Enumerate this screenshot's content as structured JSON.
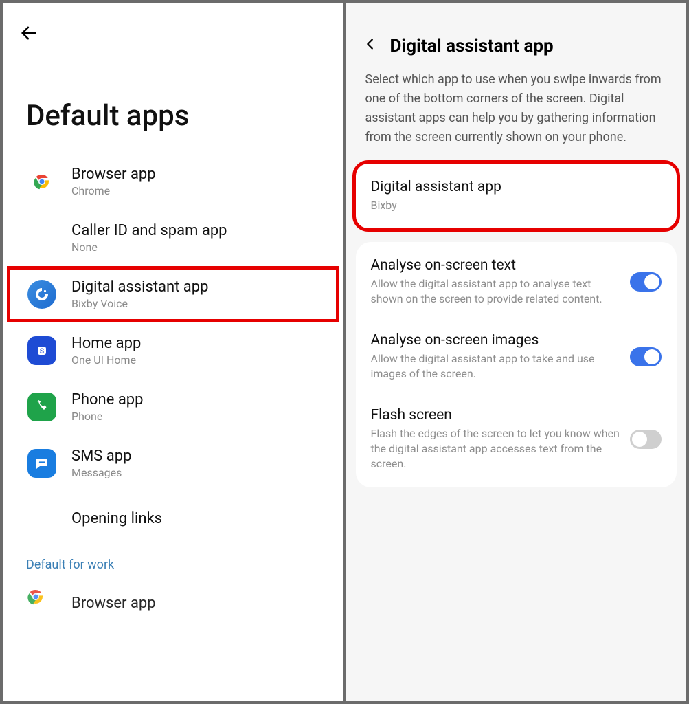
{
  "left": {
    "title": "Default apps",
    "items": [
      {
        "icon": "chrome",
        "title": "Browser app",
        "sub": "Chrome"
      },
      {
        "icon": "",
        "title": "Caller ID and spam app",
        "sub": "None"
      },
      {
        "icon": "bixby",
        "title": "Digital assistant app",
        "sub": "Bixby Voice"
      },
      {
        "icon": "samsung-home",
        "title": "Home app",
        "sub": "One UI Home"
      },
      {
        "icon": "phone",
        "title": "Phone app",
        "sub": "Phone"
      },
      {
        "icon": "messages",
        "title": "SMS app",
        "sub": "Messages"
      },
      {
        "icon": "",
        "title": "Opening links",
        "sub": ""
      }
    ],
    "footer_link": "Default for work",
    "partial_row": {
      "icon": "chrome",
      "title": "Browser app"
    }
  },
  "right": {
    "title": "Digital assistant app",
    "description": "Select which app to use when you swipe inwards from one of the bottom corners of the screen. Digital assistant apps can help you by gathering information from the screen currently shown on your phone.",
    "selected": {
      "title": "Digital assistant app",
      "sub": "Bixby"
    },
    "settings": [
      {
        "title": "Analyse on-screen text",
        "sub": "Allow the digital assistant app to analyse text shown on the screen to provide related content.",
        "on": true
      },
      {
        "title": "Analyse on-screen images",
        "sub": "Allow the digital assistant app to take and use images of the screen.",
        "on": true
      },
      {
        "title": "Flash screen",
        "sub": "Flash the edges of the screen to let you know when the digital assistant app accesses text from the screen.",
        "on": false
      }
    ]
  }
}
